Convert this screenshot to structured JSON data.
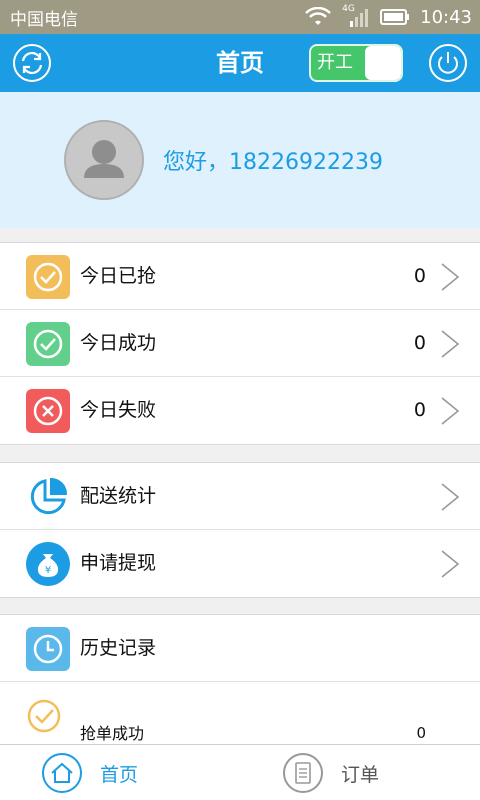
{
  "status_bar": {
    "carrier": "中国电信",
    "network": "4G",
    "time": "10:43"
  },
  "header": {
    "title": "首页",
    "toggle_label": "开工"
  },
  "profile": {
    "greeting": "您好，18226922239"
  },
  "stats": [
    {
      "label": "今日已抢",
      "value": "0",
      "color": "#f3be5a"
    },
    {
      "label": "今日成功",
      "value": "0",
      "color": "#63cf8c"
    },
    {
      "label": "今日失败",
      "value": "0",
      "color": "#f05c5c"
    }
  ],
  "menu": [
    {
      "label": "配送统计"
    },
    {
      "label": "申请提现"
    }
  ],
  "history": {
    "label": "历史记录",
    "items": [
      {
        "label": "抢单成功",
        "value": "0"
      }
    ]
  },
  "tabs": [
    {
      "label": "首页"
    },
    {
      "label": "订单"
    }
  ],
  "colors": {
    "primary": "#1c9ce3",
    "toggle_on": "#45c66a",
    "profile_bg": "#dff1fc"
  }
}
